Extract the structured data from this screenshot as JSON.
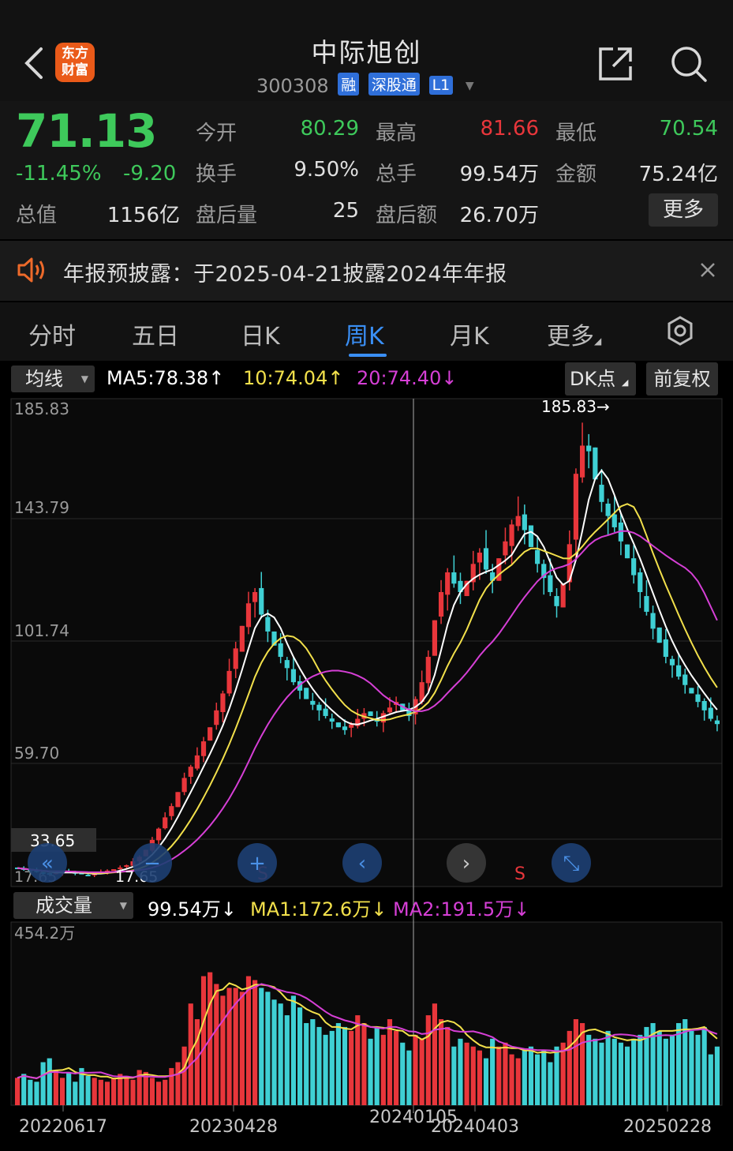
{
  "header": {
    "logo_line1": "东方",
    "logo_line2": "财富",
    "stock_name": "中际旭创",
    "stock_code": "300308",
    "badges": [
      "融",
      "深股通",
      "L1"
    ]
  },
  "quote": {
    "price": "71.13",
    "change_pct": "-11.45%",
    "change_abs": "-9.20",
    "market_cap_label": "总值",
    "market_cap_value": "1156亿",
    "fields": [
      {
        "label": "今开",
        "value": "80.29",
        "color": "#3ec95b"
      },
      {
        "label": "最高",
        "value": "81.66",
        "color": "#e8363b"
      },
      {
        "label": "最低",
        "value": "70.54",
        "color": "#3ec95b"
      },
      {
        "label": "换手",
        "value": "9.50%",
        "color": "#e0e0e0"
      },
      {
        "label": "总手",
        "value": "99.54万",
        "color": "#e0e0e0"
      },
      {
        "label": "金额",
        "value": "75.24亿",
        "color": "#e0e0e0"
      },
      {
        "label": "盘后量",
        "value": "25",
        "color": "#e0e0e0"
      },
      {
        "label": "盘后额",
        "value": "26.70万",
        "color": "#e0e0e0"
      }
    ],
    "more_label": "更多"
  },
  "notice": {
    "text": "年报预披露：于2025-04-21披露2024年年报"
  },
  "tabs": [
    {
      "label": "分时",
      "active": false
    },
    {
      "label": "五日",
      "active": false
    },
    {
      "label": "日K",
      "active": false
    },
    {
      "label": "周K",
      "active": true
    },
    {
      "label": "月K",
      "active": false
    },
    {
      "label": "更多",
      "active": false
    }
  ],
  "indicator_row": {
    "selector_label": "均线",
    "ma5": "MA5:78.38",
    "ma10": "10:74.04",
    "ma20": "20:74.40",
    "dk_label": "DK点",
    "adjust_label": "前复权",
    "colors": {
      "ma5": "#ffffff",
      "ma10": "#f2e04b",
      "ma20": "#d63fd6"
    }
  },
  "volume_row": {
    "selector_label": "成交量",
    "vol": "99.54万",
    "ma1": "MA1:172.6万",
    "ma2": "MA2:191.5万"
  },
  "chart_data": {
    "type": "candlestick",
    "price_axis_labels": [
      "185.83",
      "143.79",
      "101.74",
      "59.70"
    ],
    "price_range": [
      17.65,
      185.83
    ],
    "high_annotation": "185.83→",
    "low_annotation": "17.65",
    "left_low_label": "17.65",
    "crosshair_price_label": "33.65",
    "signal_labels": [
      "S",
      "S"
    ],
    "volume_axis_label": "454.2万",
    "volume_max": 454.2,
    "x_tick_labels": [
      "20220617",
      "20230428",
      "20240105",
      "20240403",
      "20250228"
    ],
    "weekly_closes": [
      20,
      19.5,
      19,
      18.6,
      18.2,
      18,
      18.4,
      18.9,
      18.5,
      18.1,
      17.8,
      17.65,
      18,
      18.6,
      19.1,
      19.6,
      20.2,
      21,
      22.4,
      24,
      26.5,
      30,
      34,
      38,
      42,
      47,
      52,
      56,
      60,
      65,
      70,
      76,
      82,
      90,
      98,
      106,
      114,
      118,
      110,
      104,
      99,
      95,
      91,
      86,
      83,
      80,
      78,
      76,
      74,
      72,
      70,
      69,
      71,
      73,
      75,
      74,
      72,
      75,
      77,
      79,
      76,
      74,
      80,
      86,
      95,
      108,
      118,
      125,
      121,
      118,
      122,
      128,
      132,
      126,
      122,
      130,
      136,
      142,
      145,
      140,
      134,
      128,
      123,
      118,
      113,
      121,
      135,
      160,
      170,
      168,
      158,
      150,
      145,
      141,
      136,
      130,
      124,
      118,
      111,
      105,
      100,
      95,
      92,
      88,
      85,
      82,
      79,
      76,
      73,
      71.13
    ],
    "volume_values_wan": [
      70,
      80,
      65,
      60,
      110,
      120,
      90,
      70,
      85,
      60,
      95,
      75,
      70,
      65,
      60,
      70,
      80,
      75,
      65,
      90,
      85,
      70,
      60,
      65,
      95,
      110,
      150,
      260,
      220,
      330,
      340,
      310,
      280,
      300,
      300,
      290,
      330,
      320,
      300,
      290,
      270,
      260,
      230,
      280,
      250,
      210,
      220,
      200,
      180,
      190,
      210,
      200,
      190,
      230,
      210,
      170,
      200,
      180,
      220,
      190,
      160,
      140,
      180,
      170,
      230,
      260,
      220,
      200,
      150,
      170,
      160,
      150,
      140,
      120,
      170,
      150,
      160,
      130,
      120,
      140,
      150,
      130,
      140,
      110,
      150,
      160,
      190,
      220,
      210,
      180,
      170,
      160,
      190,
      170,
      160,
      150,
      170,
      180,
      200,
      210,
      190,
      170,
      180,
      210,
      220,
      190,
      180,
      200,
      130,
      150
    ]
  }
}
